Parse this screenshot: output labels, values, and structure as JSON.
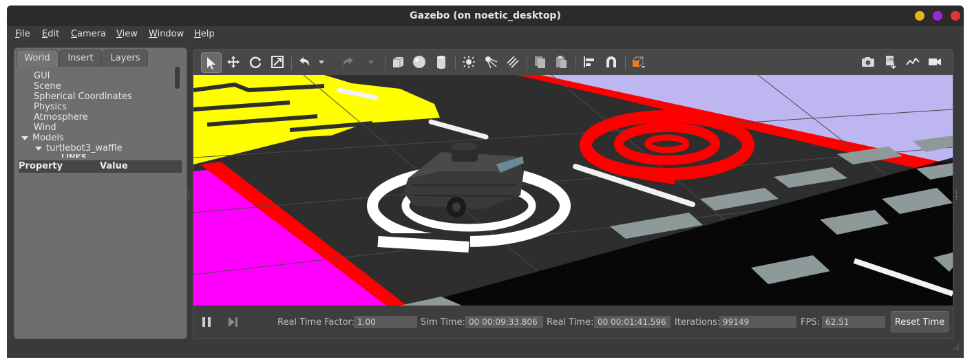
{
  "window": {
    "title": "Gazebo (on noetic_desktop)"
  },
  "window_controls": {
    "minimize_color": "#e8b21c",
    "maximize_color": "#9c27d6",
    "close_color": "#e03535"
  },
  "menubar": [
    "File",
    "Edit",
    "Camera",
    "View",
    "Window",
    "Help"
  ],
  "left_panel": {
    "tabs": [
      "World",
      "Insert",
      "Layers"
    ],
    "active_tab": "World",
    "tree": {
      "gui": "GUI",
      "scene": "Scene",
      "spherical": "Spherical Coordinates",
      "physics": "Physics",
      "atmosphere": "Atmosphere",
      "wind": "Wind",
      "models": "Models",
      "model_name": "turtlebot3_waffle",
      "links": "LINKS"
    },
    "property_header": {
      "property": "Property",
      "value": "Value"
    }
  },
  "toolbar": {
    "left_icons": [
      "select-arrow-icon",
      "translate-icon",
      "rotate-icon",
      "scale-icon",
      "undo-icon",
      "redo-icon",
      "box-icon",
      "sphere-icon",
      "cylinder-icon",
      "point-light-icon",
      "spot-light-icon",
      "directional-light-icon",
      "copy-icon",
      "paste-icon",
      "align-icon",
      "snap-icon",
      "view-angle-icon"
    ],
    "right_icons": [
      "screenshot-icon",
      "log-icon",
      "plot-icon",
      "record-video-icon"
    ]
  },
  "bottom_bar": {
    "real_time_factor_label": "Real Time Factor:",
    "real_time_factor": "1.00",
    "sim_time_label": "Sim Time:",
    "sim_time": "00 00:09:33.806",
    "real_time_label": "Real Time:",
    "real_time": "00 00:01:41.596",
    "iterations_label": "Iterations:",
    "iterations": "99149",
    "fps_label": "FPS:",
    "fps": "62.51",
    "reset_label": "Reset Time"
  },
  "colors": {
    "accent_yellow": "#ffff00",
    "accent_magenta": "#ff00ff",
    "accent_red": "#ff0000",
    "accent_lavender": "#bdb6f0",
    "floor": "#2e2e2e"
  }
}
